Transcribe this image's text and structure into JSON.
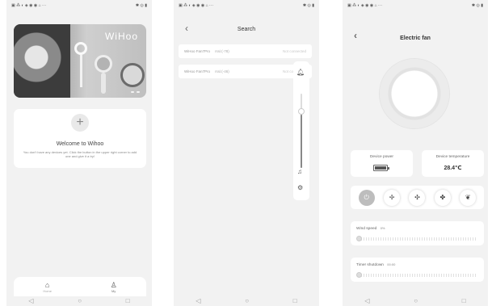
{
  "screen1": {
    "banner": {
      "brand": "WiHoo"
    },
    "welcome": {
      "plus": "+",
      "title": "Welcome to Wihoo",
      "description": "You don't have any devices yet. Click the button in the upper right corner to add one and give it a try!"
    },
    "tabs": [
      {
        "label": "Home",
        "icon": "home-icon"
      },
      {
        "label": "My",
        "icon": "person-icon"
      }
    ]
  },
  "screen2": {
    "title": "Search",
    "devices": [
      {
        "name": "WiHoo Fan7Pro",
        "rssi": "rssi:(-78)",
        "status": "Not connected"
      },
      {
        "name": "WiHoo Fan7Pro",
        "rssi": "rssi:(-46)",
        "status": "Not connected"
      }
    ],
    "side_panel": {
      "icons": [
        "bell-icon",
        "music-icon",
        "gear-icon"
      ],
      "slider_level": 0.72
    }
  },
  "screen3": {
    "title": "Electric fan",
    "device_power": {
      "label": "Device power",
      "icon": "battery-icon"
    },
    "device_temperature": {
      "label": "Device temperature",
      "value": "28.4℃"
    },
    "modes": [
      "power-icon",
      "fan-mode-1-icon",
      "fan-mode-2-icon",
      "fan-mode-3-icon",
      "leaf-icon"
    ],
    "wind_speed": {
      "label": "Wind speed",
      "value": "0%"
    },
    "timer": {
      "label": "Timer shutdown",
      "value": "00:00"
    }
  },
  "system_nav": {
    "icons": [
      "back-icon",
      "home-circle-icon",
      "recents-icon"
    ]
  }
}
